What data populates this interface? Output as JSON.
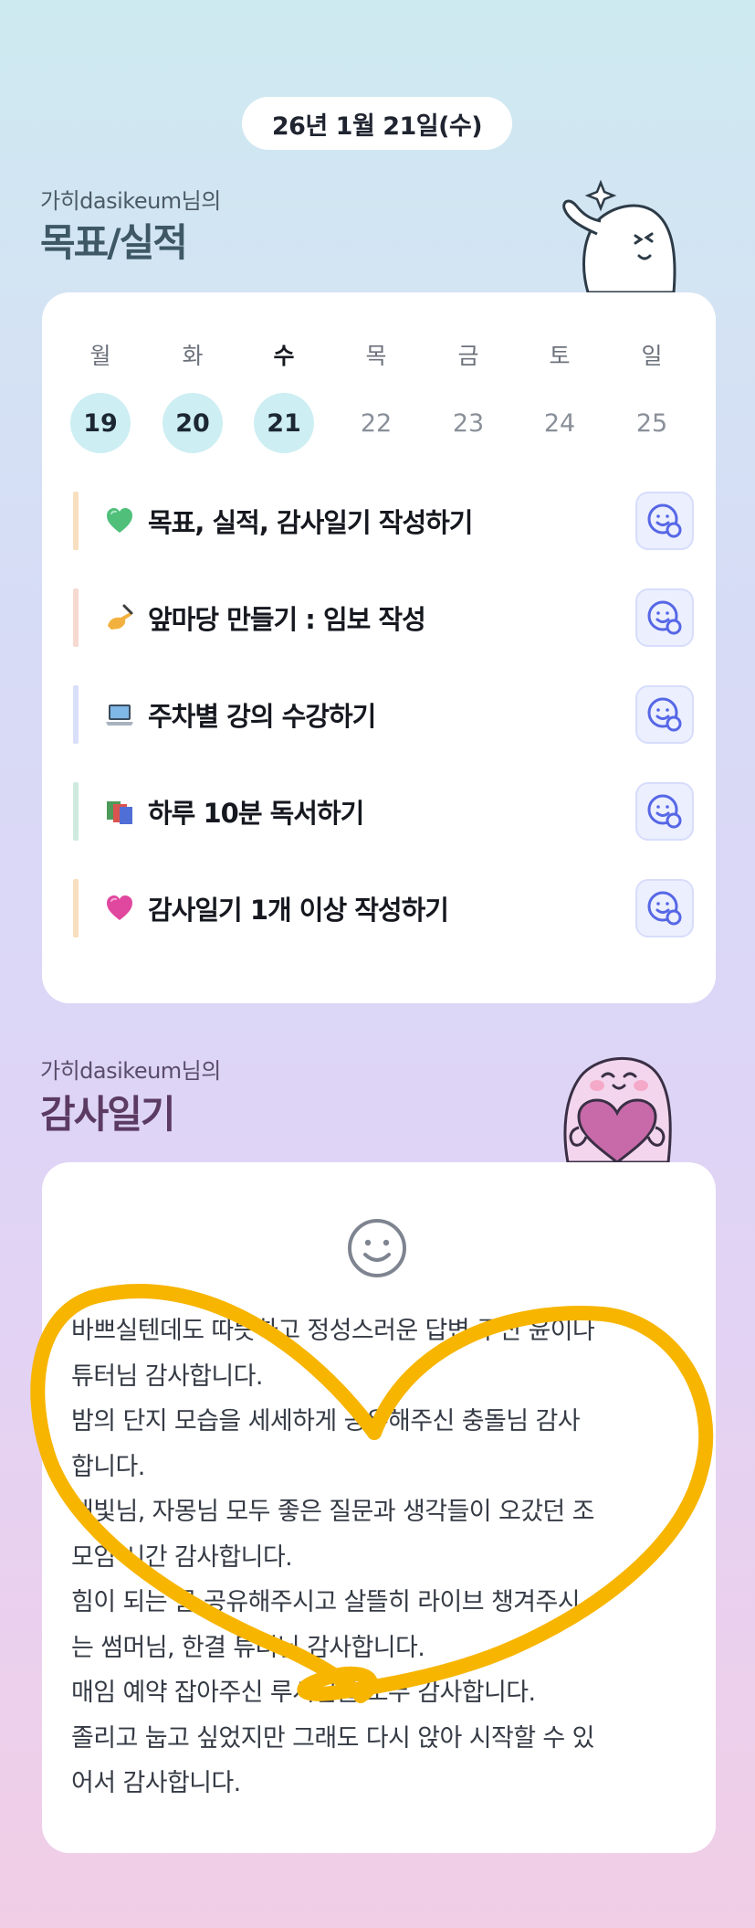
{
  "header": {
    "date": "26년 1월 21일(수)"
  },
  "goals_section": {
    "owner_line": "가히dasikeum님의",
    "title": "목표/실적"
  },
  "week": {
    "days": [
      {
        "label": "월",
        "date": "19",
        "done": true,
        "today": false
      },
      {
        "label": "화",
        "date": "20",
        "done": true,
        "today": false
      },
      {
        "label": "수",
        "date": "21",
        "done": true,
        "today": true
      },
      {
        "label": "목",
        "date": "22",
        "done": false,
        "today": false
      },
      {
        "label": "금",
        "date": "23",
        "done": false,
        "today": false
      },
      {
        "label": "토",
        "date": "24",
        "done": false,
        "today": false
      },
      {
        "label": "일",
        "date": "25",
        "done": false,
        "today": false
      }
    ]
  },
  "goals": [
    {
      "icon": "green-heart-icon",
      "text": "목표, 실적, 감사일기 작성하기",
      "bar_color": "#f7dfbf"
    },
    {
      "icon": "writing-hand-icon",
      "text": "앞마당 만들기 : 임보 작성",
      "bar_color": "#f6d9d0"
    },
    {
      "icon": "laptop-icon",
      "text": "주차별 강의 수강하기",
      "bar_color": "#dadff9"
    },
    {
      "icon": "books-icon",
      "text": "하루 10분 독서하기",
      "bar_color": "#cfeadf"
    },
    {
      "icon": "pink-heart-icon",
      "text": "감사일기 1개 이상 작성하기",
      "bar_color": "#f7dfbf"
    }
  ],
  "diary_section": {
    "owner_line": "가히dasikeum님의",
    "title": "감사일기"
  },
  "diary": {
    "mood_icon": "smiley-face-icon",
    "lines": [
      "바쁘실텐데도 따뜻하고 정성스러운 답변 주신 윤이나",
      "튜터님 감사합니다.",
      "밤의 단지 모습을 세세하게 공유해주신 충돌님 감사",
      "합니다.",
      "해빛님, 자몽님 모두 좋은 질문과 생각들이 오갔던 조",
      "모임 시간 감사합니다.",
      "힘이 되는 글 공유해주시고 살뜰히 라이브 챙겨주시",
      "는 썸머님, 한결 튜터님 감사합니다.",
      "매임 예약 잡아주신 루시님들 모두 감사합니다.",
      "졸리고 눕고 싶었지만 그래도 다시 앉아 시작할 수 있",
      "어서 감사합니다."
    ]
  },
  "colors": {
    "goals_title": "#3e5866",
    "diary_title": "#5c3b63",
    "scribble": "#f7b500"
  }
}
